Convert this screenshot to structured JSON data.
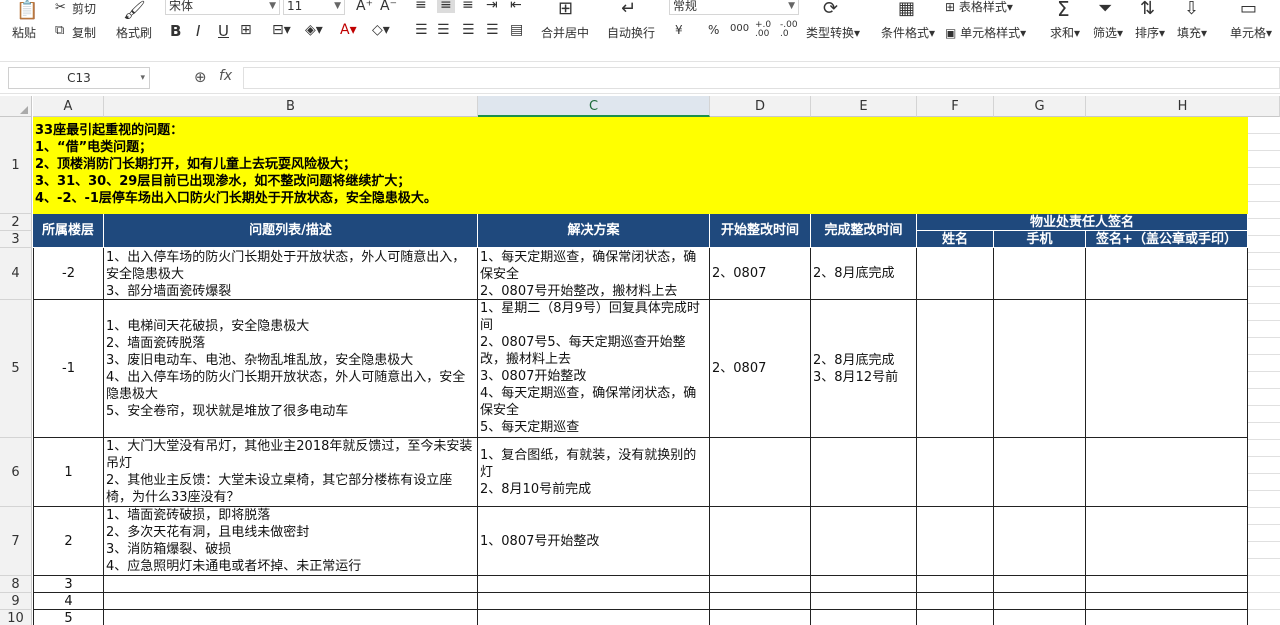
{
  "ribbon": {
    "paste": "粘贴",
    "cut": "剪切",
    "copy": "复制",
    "format_painter": "格式刷",
    "font_name": "宋体",
    "font_size": "11",
    "merge": "合并居中",
    "wrap": "自动换行",
    "number_format": "常规",
    "type_convert": "类型转换",
    "cond_format": "条件格式",
    "table_style": "表格样式",
    "cell_style": "单元格样式",
    "sum": "求和",
    "filter": "筛选",
    "sort": "排序",
    "fill": "填充",
    "cell": "单元格",
    "bold": "B",
    "italic": "I",
    "underline": "U",
    "currency": "¥",
    "percent": "%",
    "thousands": "000",
    "dec_inc": "+.0 .00",
    "dec_dec": "-.00 .0"
  },
  "formula_bar": {
    "cell_ref": "C13",
    "fx": "fx",
    "value": ""
  },
  "columns": [
    "A",
    "B",
    "C",
    "D",
    "E",
    "F",
    "G",
    "H"
  ],
  "rows": [
    "1",
    "2",
    "3",
    "4",
    "5",
    "6",
    "7",
    "8",
    "9",
    "10"
  ],
  "note": [
    "33座最引起重视的问题：",
    "1、“借”电类问题；",
    "2、顶楼消防门长期打开，如有儿童上去玩耍风险极大；",
    "3、31、30、29层目前已出现渗水，如不整改问题将继续扩大；",
    "4、-2、-1层停车场出入口防火门长期处于开放状态，安全隐患极大。"
  ],
  "headers": {
    "floor": "所属楼层",
    "issue": "问题列表/描述",
    "solution": "解决方案",
    "start": "开始整改时间",
    "finish": "完成整改时间",
    "sign_group": "物业处责任人签名",
    "name": "姓名",
    "phone": "手机",
    "signature": "签名+（盖公章或手印）"
  },
  "table": [
    {
      "floor": "-2",
      "issue": "1、出入停车场的防火门长期处于开放状态，外人可随意出入，安全隐患极大\n3、部分墙面瓷砖爆裂",
      "solution": "1、每天定期巡查，确保常闭状态，确保安全\n2、0807号开始整改，搬材料上去",
      "start": "2、0807",
      "finish": "2、8月底完成"
    },
    {
      "floor": "-1",
      "issue": "1、电梯间天花破损，安全隐患极大\n2、墙面瓷砖脱落\n3、废旧电动车、电池、杂物乱堆乱放，安全隐患极大\n4、出入停车场的防火门长期开放状态，外人可随意出入，安全隐患极大\n5、安全卷帘，现状就是堆放了很多电动车",
      "solution": "1、星期二（8月9号）回复具体完成时间\n2、0807号5、每天定期巡查开始整改，搬材料上去\n3、0807开始整改\n4、每天定期巡查，确保常闭状态，确保安全\n5、每天定期巡查",
      "start": "2、0807",
      "finish": "2、8月底完成\n3、8月12号前"
    },
    {
      "floor": "1",
      "issue": "1、大门大堂没有吊灯，其他业主2018年就反馈过，至今未安装吊灯\n2、其他业主反馈：大堂未设立桌椅，其它部分楼栋有设立座椅，为什么33座没有？",
      "solution": "1、复合图纸，有就装，没有就换别的灯\n2、8月10号前完成",
      "start": "",
      "finish": ""
    },
    {
      "floor": "2",
      "issue": "1、墙面瓷砖破损，即将脱落\n2、多次天花有洞，且电线未做密封\n3、消防箱爆裂、破损\n4、应急照明灯未通电或者坏掉、未正常运行",
      "solution": "1、0807号开始整改",
      "start": "",
      "finish": ""
    },
    {
      "floor": "3",
      "issue": "",
      "solution": "",
      "start": "",
      "finish": ""
    },
    {
      "floor": "4",
      "issue": "",
      "solution": "",
      "start": "",
      "finish": ""
    },
    {
      "floor": "5",
      "issue": "",
      "solution": "",
      "start": "",
      "finish": ""
    }
  ]
}
